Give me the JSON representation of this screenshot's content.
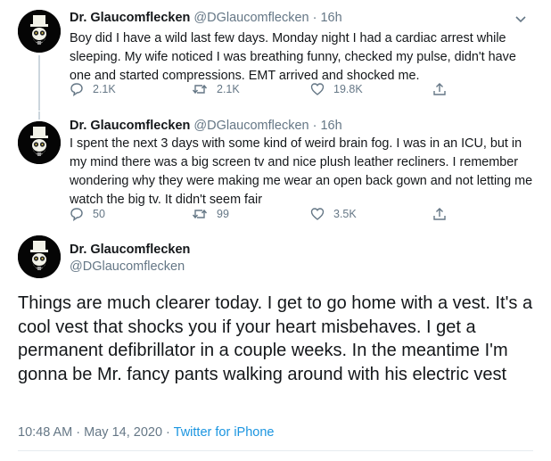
{
  "tweets": [
    {
      "name": "Dr. Glaucomflecken",
      "handle": "@DGlaucomflecken",
      "dot": "·",
      "time": "16h",
      "text": "Boy did I have a wild last few days. Monday night I had a cardiac arrest while sleeping. My wife noticed I was breathing funny, checked my pulse, didn't have one and started compressions. EMT arrived and shocked me.",
      "replies": "2.1K",
      "retweets": "2.1K",
      "likes": "19.8K"
    },
    {
      "name": "Dr. Glaucomflecken",
      "handle": "@DGlaucomflecken",
      "dot": "·",
      "time": "16h",
      "text": "I spent the next 3 days with some kind of weird brain fog. I was in an ICU, but in my mind there was a big screen tv and nice plush leather recliners. I remember wondering why they were making me wear an open back gown and not letting me watch the big tv. It didn't seem fair",
      "replies": "50",
      "retweets": "99",
      "likes": "3.5K"
    }
  ],
  "main": {
    "name": "Dr. Glaucomflecken",
    "handle": "@DGlaucomflecken",
    "text": "Things are much clearer today. I get to go home with a vest. It's a cool vest that shocks you if your heart misbehaves. I get a permanent defibrillator in a couple weeks. In the meantime I'm gonna be Mr. fancy pants walking around with his electric vest",
    "timestamp": "10:48 AM · May 14, 2020 · ",
    "source": "Twitter for iPhone"
  },
  "icons": {
    "reply": "reply-icon",
    "retweet": "retweet-icon",
    "like": "heart-icon",
    "share": "share-icon",
    "more": "chevron-down-icon",
    "avatar": "glaucomflecken-avatar"
  },
  "colors": {
    "text": "#14171a",
    "secondary": "#657786",
    "link": "#1b95e0",
    "thread_line": "#ccd6dd"
  }
}
